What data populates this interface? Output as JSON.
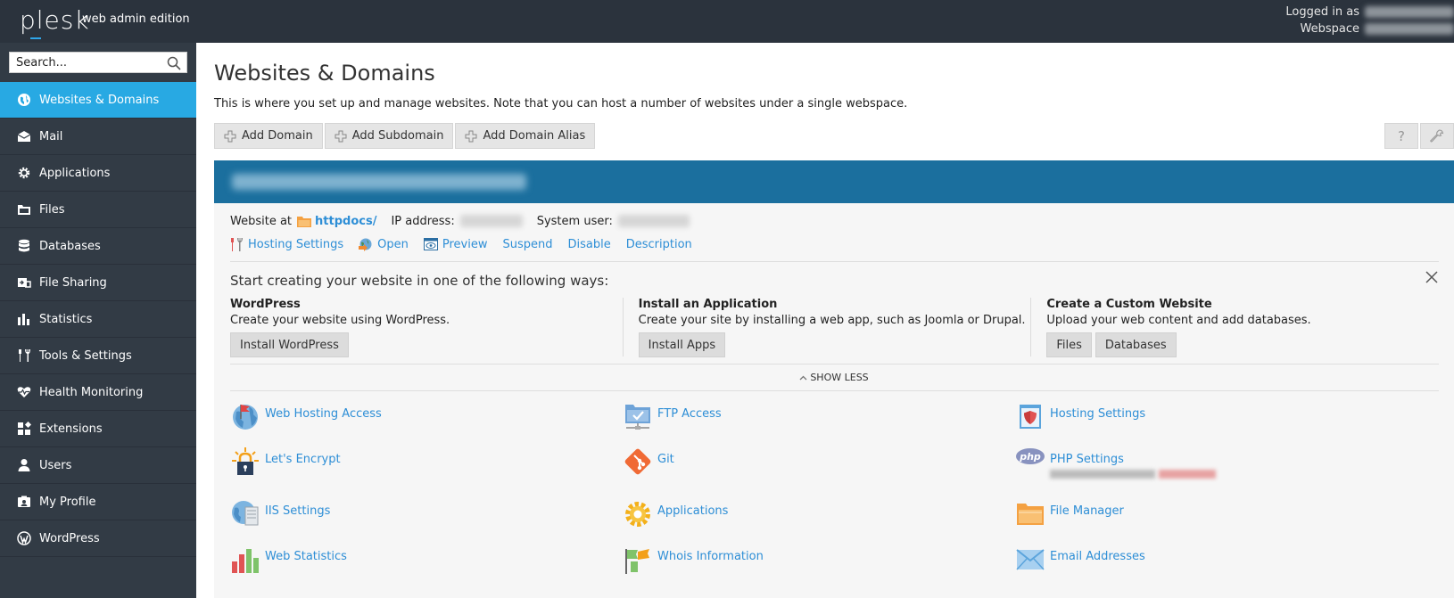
{
  "header": {
    "logo": "plesk",
    "edition": "web admin edition",
    "logged_in_label": "Logged in as",
    "webspace_label": "Webspace"
  },
  "sidebar": {
    "search_placeholder": "Search...",
    "items": [
      {
        "label": "Websites & Domains",
        "icon": "globe-icon",
        "active": true
      },
      {
        "label": "Mail",
        "icon": "mail-icon"
      },
      {
        "label": "Applications",
        "icon": "gear-icon"
      },
      {
        "label": "Files",
        "icon": "folder-icon"
      },
      {
        "label": "Databases",
        "icon": "database-icon"
      },
      {
        "label": "File Sharing",
        "icon": "file-sharing-icon"
      },
      {
        "label": "Statistics",
        "icon": "bar-chart-icon"
      },
      {
        "label": "Tools & Settings",
        "icon": "tools-icon"
      },
      {
        "label": "Health Monitoring",
        "icon": "heart-icon"
      },
      {
        "label": "Extensions",
        "icon": "extensions-icon"
      },
      {
        "label": "Users",
        "icon": "user-icon"
      },
      {
        "label": "My Profile",
        "icon": "profile-icon"
      },
      {
        "label": "WordPress",
        "icon": "wordpress-icon"
      }
    ]
  },
  "main": {
    "title": "Websites & Domains",
    "description": "This is where you set up and manage websites. Note that you can host a number of websites under a single webspace.",
    "toolbar": [
      "Add Domain",
      "Add Subdomain",
      "Add Domain Alias"
    ],
    "help_glyph": "?",
    "domain": {
      "website_at_label": "Website at",
      "website_link": "httpdocs/",
      "ip_label": "IP address:",
      "system_user_label": "System user:",
      "actions": [
        "Hosting Settings",
        "Open",
        "Preview",
        "Suspend",
        "Disable",
        "Description"
      ]
    },
    "start": {
      "title": "Start creating your website in one of the following ways:",
      "ways": [
        {
          "heading": "WordPress",
          "text": "Create your website using WordPress.",
          "buttons": [
            "Install WordPress"
          ]
        },
        {
          "heading": "Install an Application",
          "text": "Create your site by installing a web app, such as Joomla or Drupal.",
          "buttons": [
            "Install Apps"
          ]
        },
        {
          "heading": "Create a Custom Website",
          "text": "Upload your web content and add databases.",
          "buttons": [
            "Files",
            "Databases"
          ]
        }
      ],
      "show_less": "SHOW LESS"
    },
    "tools": [
      {
        "label": "Web Hosting Access",
        "icon": "web-hosting-access-icon"
      },
      {
        "label": "FTP Access",
        "icon": "ftp-access-icon"
      },
      {
        "label": "Hosting Settings",
        "icon": "hosting-settings-icon"
      },
      {
        "label": "Let's Encrypt",
        "icon": "lets-encrypt-icon"
      },
      {
        "label": "Git",
        "icon": "git-icon"
      },
      {
        "label": "PHP Settings",
        "icon": "php-icon"
      },
      {
        "label": "IIS Settings",
        "icon": "iis-settings-icon"
      },
      {
        "label": "Applications",
        "icon": "applications-gear-icon"
      },
      {
        "label": "File Manager",
        "icon": "file-manager-icon"
      },
      {
        "label": "Web Statistics",
        "icon": "web-statistics-icon"
      },
      {
        "label": "Whois Information",
        "icon": "whois-icon"
      },
      {
        "label": "Email Addresses",
        "icon": "email-addresses-icon"
      }
    ]
  }
}
